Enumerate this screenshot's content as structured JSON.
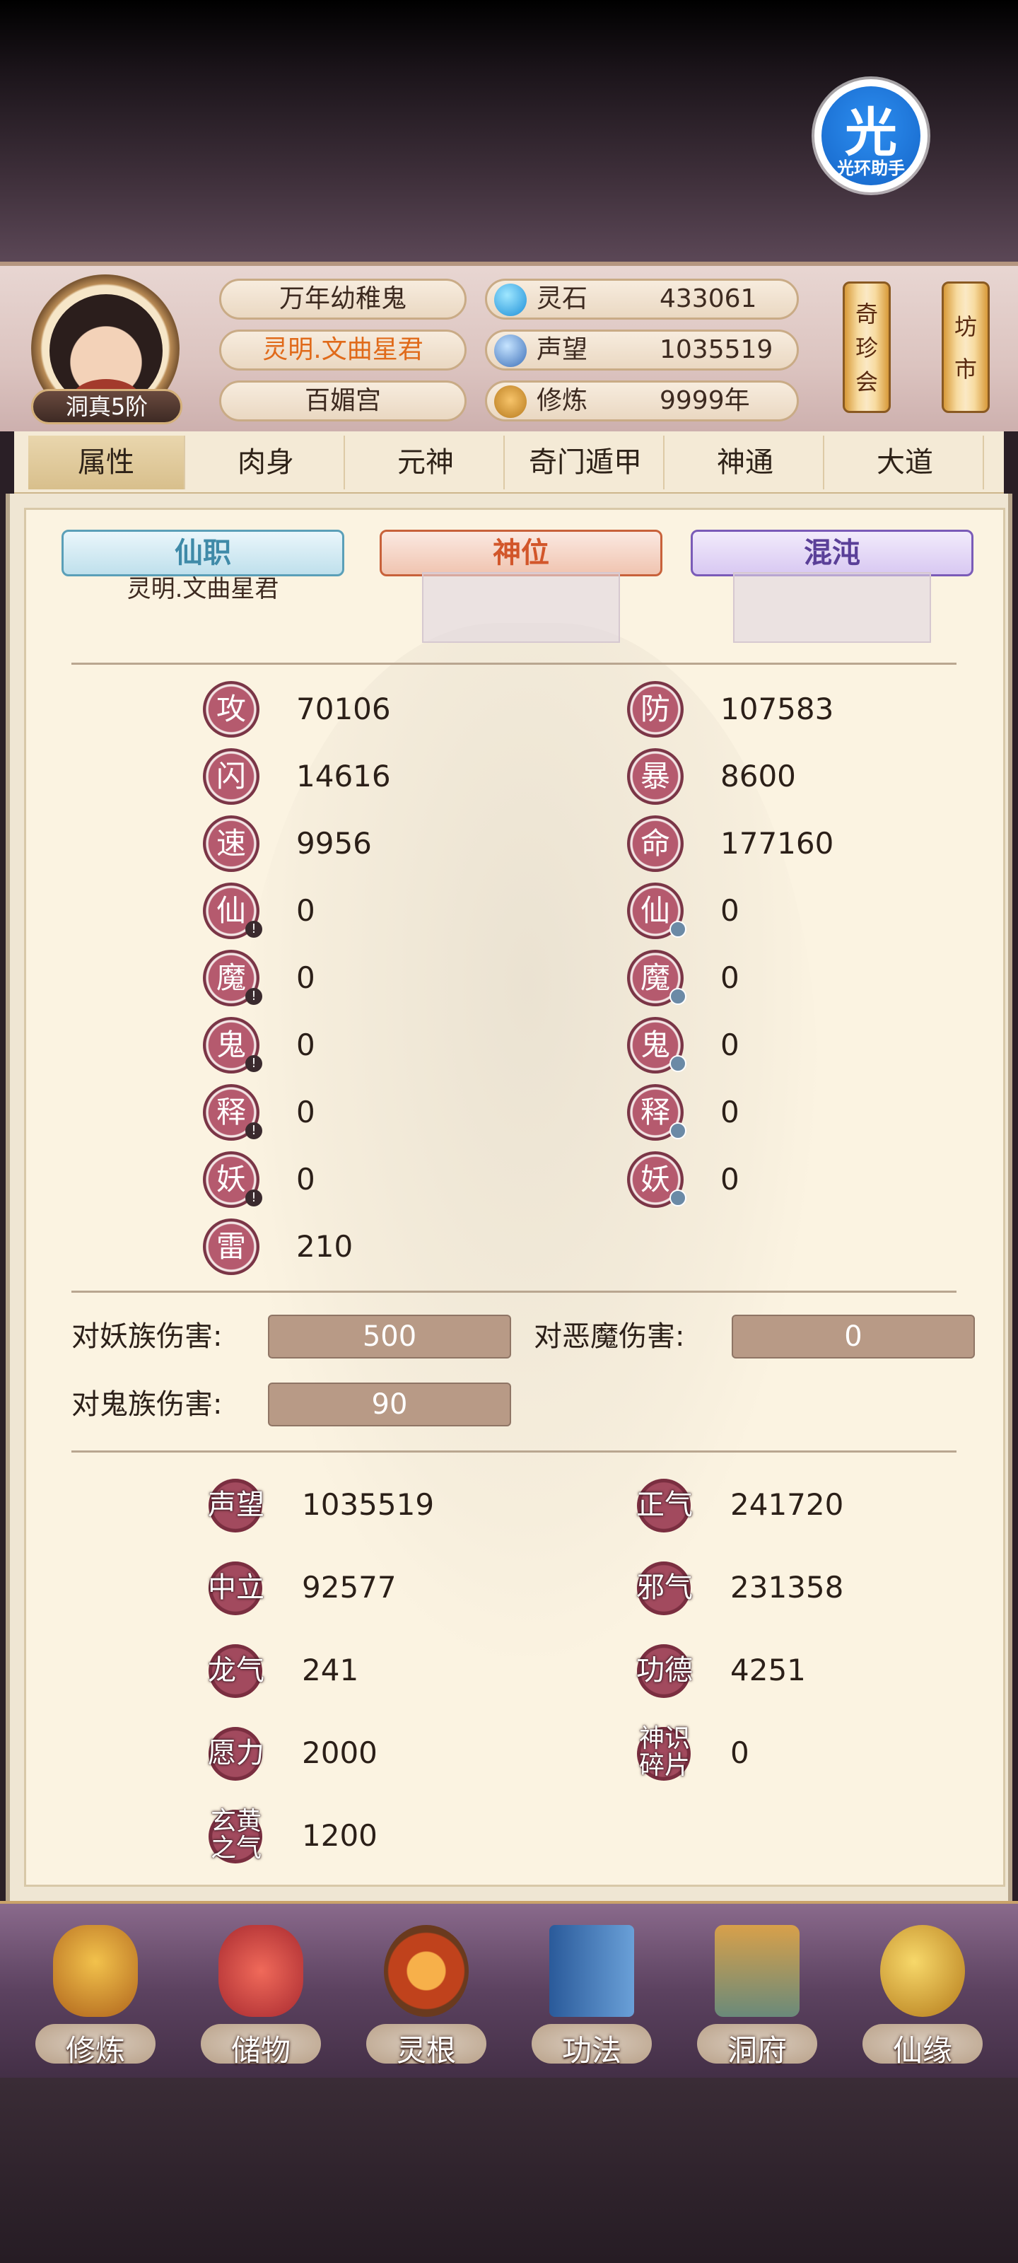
{
  "assistant": {
    "glyph": "光",
    "label": "光环助手"
  },
  "header": {
    "rank": "洞真5阶",
    "titles": [
      "万年幼稚鬼",
      "灵明.文曲星君",
      "百媚宫"
    ],
    "resources": [
      {
        "name": "灵石",
        "value": "433061",
        "icon": "spirit-stone-icon"
      },
      {
        "name": "声望",
        "value": "1035519",
        "icon": "prestige-icon"
      },
      {
        "name": "修炼",
        "value": "9999年",
        "icon": "meditation-icon"
      }
    ],
    "shop_buttons": [
      {
        "label": "奇珍会"
      },
      {
        "label": "坊市"
      }
    ]
  },
  "tabs": [
    "属性",
    "肉身",
    "元神",
    "奇门遁甲",
    "神通",
    "大道"
  ],
  "slots": [
    {
      "title": "仙职",
      "content": "灵明.文曲星君"
    },
    {
      "title": "神位",
      "content": ""
    },
    {
      "title": "混沌",
      "content": ""
    }
  ],
  "stats_left": [
    {
      "label": "攻",
      "value": "70106"
    },
    {
      "label": "闪",
      "value": "14616"
    },
    {
      "label": "速",
      "value": "9956"
    },
    {
      "label": "仙",
      "value": "0"
    },
    {
      "label": "魔",
      "value": "0"
    },
    {
      "label": "鬼",
      "value": "0"
    },
    {
      "label": "释",
      "value": "0"
    },
    {
      "label": "妖",
      "value": "0"
    },
    {
      "label": "雷",
      "value": "210"
    }
  ],
  "stats_right": [
    {
      "label": "防",
      "value": "107583"
    },
    {
      "label": "暴",
      "value": "8600"
    },
    {
      "label": "命",
      "value": "177160"
    },
    {
      "label": "仙",
      "value": "0"
    },
    {
      "label": "魔",
      "value": "0"
    },
    {
      "label": "鬼",
      "value": "0"
    },
    {
      "label": "释",
      "value": "0"
    },
    {
      "label": "妖",
      "value": "0"
    }
  ],
  "damage": [
    {
      "label": "对妖族伤害:",
      "value": "500"
    },
    {
      "label": "对恶魔伤害:",
      "value": "0"
    },
    {
      "label": "对鬼族伤害:",
      "value": "90"
    }
  ],
  "misc_left": [
    {
      "label": "声望",
      "value": "1035519"
    },
    {
      "label": "中立",
      "value": "92577"
    },
    {
      "label": "龙气",
      "value": "241"
    },
    {
      "label": "愿力",
      "value": "2000"
    },
    {
      "label": "玄黄之气",
      "value": "1200"
    }
  ],
  "misc_right": [
    {
      "label": "正气",
      "value": "241720"
    },
    {
      "label": "邪气",
      "value": "231358"
    },
    {
      "label": "功德",
      "value": "4251"
    },
    {
      "label": "神识碎片",
      "value": "0"
    }
  ],
  "nav": [
    "修炼",
    "储物",
    "灵根",
    "功法",
    "洞府",
    "仙缘"
  ],
  "colors": {
    "accent": "#e06a1a",
    "badge": "#8a3a4e",
    "damage_bar": "#b89a86"
  }
}
